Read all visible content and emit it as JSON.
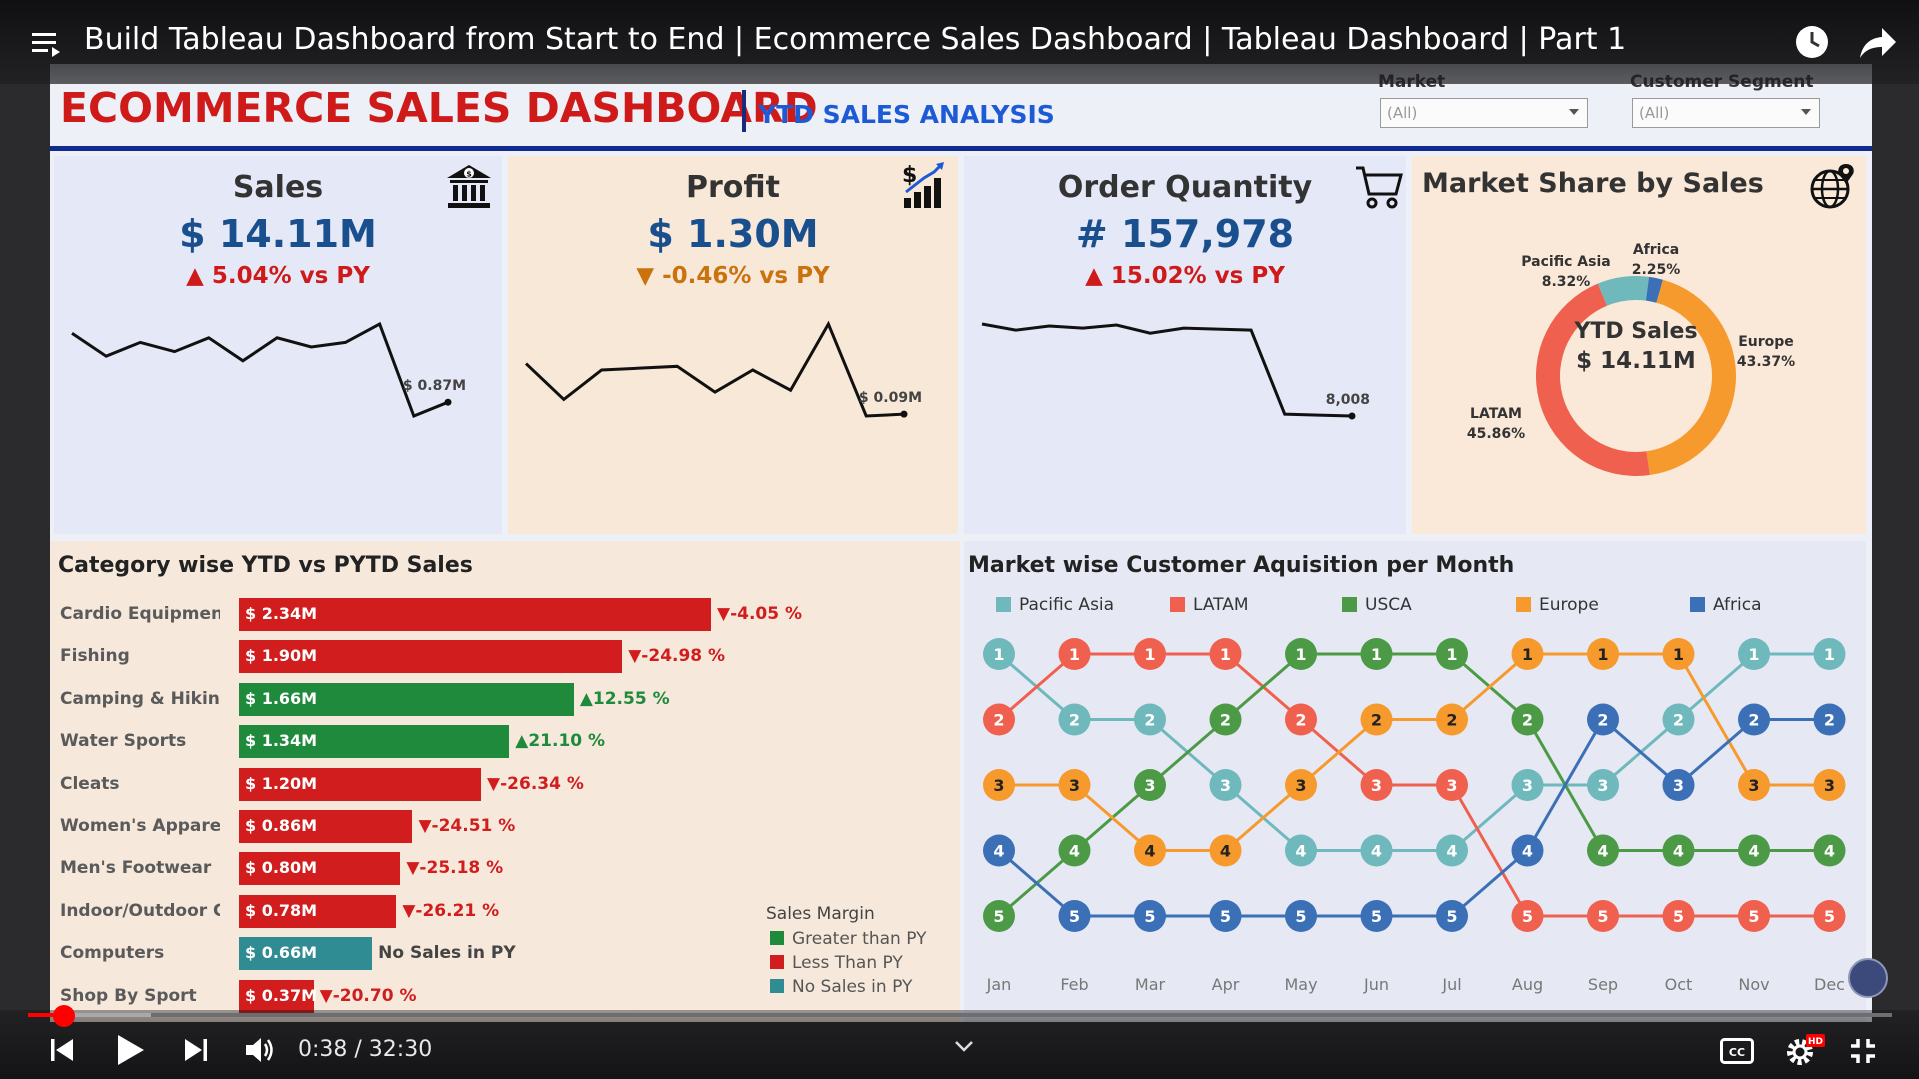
{
  "video": {
    "title": "Build Tableau Dashboard from Start to End | Ecommerce Sales Dashboard | Tableau Dashboard | Part 1",
    "current_time": "0:38",
    "duration": "32:30",
    "time_display": "0:38 / 32:30",
    "progress": 0.0195,
    "buffered": 0.066,
    "accent_color": "#ff0000"
  },
  "dashboard": {
    "title": "ECOMMERCE SALES DASHBOARD",
    "subtitle": "YTD SALES ANALYSIS",
    "filters": [
      {
        "label": "Market",
        "value": "(All)"
      },
      {
        "label": "Customer Segment",
        "value": "(All)"
      }
    ],
    "kpis": [
      {
        "title": "Sales",
        "value": "$ 14.11M",
        "delta": "5.04% vs PY",
        "direction": "up",
        "icon": "bank-dollar-icon",
        "last_label": "$ 0.87M",
        "trend": [
          0.74,
          0.69,
          0.72,
          0.7,
          0.73,
          0.68,
          0.73,
          0.71,
          0.72,
          0.76,
          0.56,
          0.59
        ]
      },
      {
        "title": "Profit",
        "value": "$ 1.30M",
        "delta": "-0.46% vs PY",
        "direction": "down",
        "icon": "profit-chart-icon",
        "last_label": "$ 0.09M",
        "trend": [
          0.125,
          0.086,
          0.118,
          0.12,
          0.122,
          0.094,
          0.118,
          0.096,
          0.168,
          0.068,
          0.07
        ]
      },
      {
        "title": "Order Quantity",
        "value": "# 157,978",
        "delta": "15.02% vs PY",
        "direction": "up",
        "icon": "shopping-cart-icon",
        "last_label": "8,008",
        "trend": [
          12500,
          12200,
          12400,
          12300,
          12450,
          12050,
          12300,
          12250,
          12200,
          8100,
          8050,
          8008
        ]
      }
    ],
    "market_share": {
      "title": "Market Share by Sales",
      "center_label": "YTD Sales",
      "center_value": "$ 14.11M",
      "icon": "globe-pin-icon"
    }
  },
  "category_panel": {
    "title": "Category wise YTD vs PYTD Sales",
    "legend_title": "Sales Margin",
    "legend": [
      {
        "label": "Greater than PY",
        "color": "#1f8a3c"
      },
      {
        "label": "Less Than PY",
        "color": "#d11d1d"
      },
      {
        "label": "No Sales in PY",
        "color": "#2e8c92"
      }
    ]
  },
  "mca_panel": {
    "title": "Market wise Customer Aquisition per Month"
  },
  "chart_data": [
    {
      "type": "pie",
      "title": "Market Share by Sales",
      "categories": [
        "Pacific Asia",
        "Africa",
        "Europe",
        "LATAM"
      ],
      "values": [
        8.32,
        2.25,
        43.37,
        45.86
      ],
      "labels": [
        "8.32%",
        "2.25%",
        "43.37%",
        "45.86%"
      ],
      "colors": [
        "#6fb8bc",
        "#3b6fb6",
        "#f79a2e",
        "#f0604e"
      ]
    },
    {
      "type": "bar",
      "title": "Category wise YTD vs PYTD Sales",
      "categories": [
        "Cardio Equipment",
        "Fishing",
        "Camping & Hiking",
        "Water Sports",
        "Cleats",
        "Women's Apparel",
        "Men's Footwear",
        "Indoor/Outdoor Ga..",
        "Computers",
        "Shop By Sport"
      ],
      "values": [
        2.34,
        1.9,
        1.66,
        1.34,
        1.2,
        0.86,
        0.8,
        0.78,
        0.66,
        0.37
      ],
      "value_labels": [
        "$ 2.34M",
        "$ 1.90M",
        "$ 1.66M",
        "$ 1.34M",
        "$ 1.20M",
        "$ 0.86M",
        "$ 0.80M",
        "$ 0.78M",
        "$ 0.66M",
        "$ 0.37M"
      ],
      "change_labels": [
        "-4.05 %",
        "-24.98 %",
        "12.55 %",
        "21.10 %",
        "-26.34 %",
        "-24.51 %",
        "-25.18 %",
        "-26.21 %",
        "No Sales in PY",
        "-20.70 %"
      ],
      "status": [
        "less",
        "less",
        "greater",
        "greater",
        "less",
        "less",
        "less",
        "less",
        "none",
        "less"
      ],
      "xlim": [
        0,
        2.34
      ]
    },
    {
      "type": "line",
      "title": "Market wise Customer Aquisition per Month",
      "x": [
        "Jan",
        "Feb",
        "Mar",
        "Apr",
        "May",
        "Jun",
        "Jul",
        "Aug",
        "Sep",
        "Oct",
        "Nov",
        "Dec"
      ],
      "ylim": [
        1,
        5
      ],
      "y_reversed": true,
      "series": [
        {
          "name": "Pacific Asia",
          "color": "#6fb8bc",
          "values": [
            1,
            2,
            2,
            3,
            4,
            4,
            4,
            3,
            3,
            2,
            1,
            1
          ]
        },
        {
          "name": "LATAM",
          "color": "#f0604e",
          "values": [
            2,
            1,
            1,
            1,
            2,
            3,
            3,
            5,
            5,
            5,
            5,
            5
          ]
        },
        {
          "name": "USCA",
          "color": "#4c9a46",
          "values": [
            5,
            4,
            3,
            2,
            1,
            1,
            1,
            2,
            4,
            4,
            4,
            4
          ]
        },
        {
          "name": "Europe",
          "color": "#f79a2e",
          "values": [
            3,
            3,
            4,
            4,
            3,
            2,
            2,
            1,
            1,
            1,
            3,
            3
          ]
        },
        {
          "name": "Africa",
          "color": "#3b6fb6",
          "values": [
            4,
            5,
            5,
            5,
            5,
            5,
            5,
            4,
            2,
            3,
            2,
            2
          ]
        }
      ]
    }
  ]
}
